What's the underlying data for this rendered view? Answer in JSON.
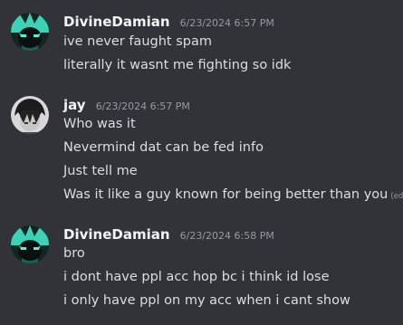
{
  "theme": {
    "background": "#313338",
    "author_color": "#f2f3f5",
    "text_color": "#dbdee1",
    "muted_color": "#949ba4",
    "avatar_accent": "#3ad3b8"
  },
  "groups": [
    {
      "author": "DivineDamian",
      "timestamp": "6/23/2024 6:57 PM",
      "avatar_icon": "teal-anime-character-avatar",
      "messages": [
        "ive never faught spam",
        "literally it wasnt me fighting so idk"
      ]
    },
    {
      "author": "jay",
      "timestamp": "6/23/2024 6:57 PM",
      "avatar_icon": "dark-haired-character-avatar",
      "messages": [
        "Who was it",
        "Nevermind dat can be fed info",
        "Just tell me",
        "Was it like a guy known for being better than you"
      ],
      "edited_label": "(edited)"
    },
    {
      "author": "DivineDamian",
      "timestamp": "6/23/2024 6:58 PM",
      "avatar_icon": "teal-anime-character-avatar",
      "messages": [
        "bro",
        "i dont have ppl acc hop bc i think id lose",
        "i only have ppl on my acc when i cant show"
      ]
    }
  ]
}
